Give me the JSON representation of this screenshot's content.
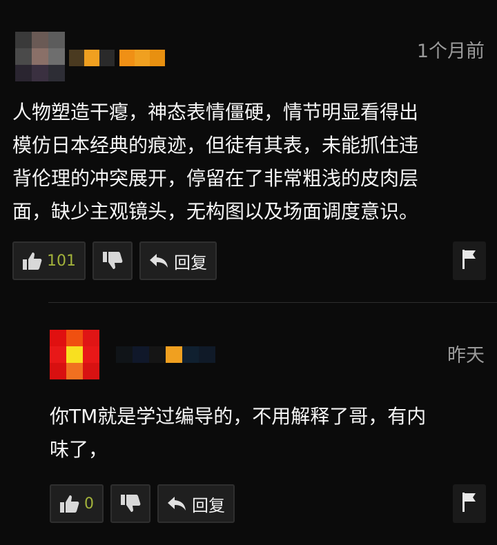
{
  "comments": [
    {
      "time": "1个月前",
      "text": "人物塑造干瘪，神态表情僵硬，情节明显看得出\n模仿日本经典的痕迹，但徒有其表，未能抓住违\n背伦理的冲突展开，停留在了非常粗浅的皮肉层\n面，缺少主观镜头，无构图以及场面调度意识。",
      "likes": "101",
      "reply_label": "回复",
      "icons": {
        "like": "thumbs-up-icon",
        "dislike": "thumbs-down-icon",
        "reply": "reply-arrow-icon",
        "report": "flag-icon"
      }
    },
    {
      "time": "昨天",
      "text": "你TM就是学过编导的，不用解释了哥，有内\n味了，",
      "likes": "0",
      "reply_label": "回复",
      "icons": {
        "like": "thumbs-up-icon",
        "dislike": "thumbs-down-icon",
        "reply": "reply-arrow-icon",
        "report": "flag-icon"
      }
    }
  ],
  "colors": {
    "background": "#0b0b0b",
    "like_count": "#a3b33b",
    "timestamp": "#9a9a9a"
  }
}
